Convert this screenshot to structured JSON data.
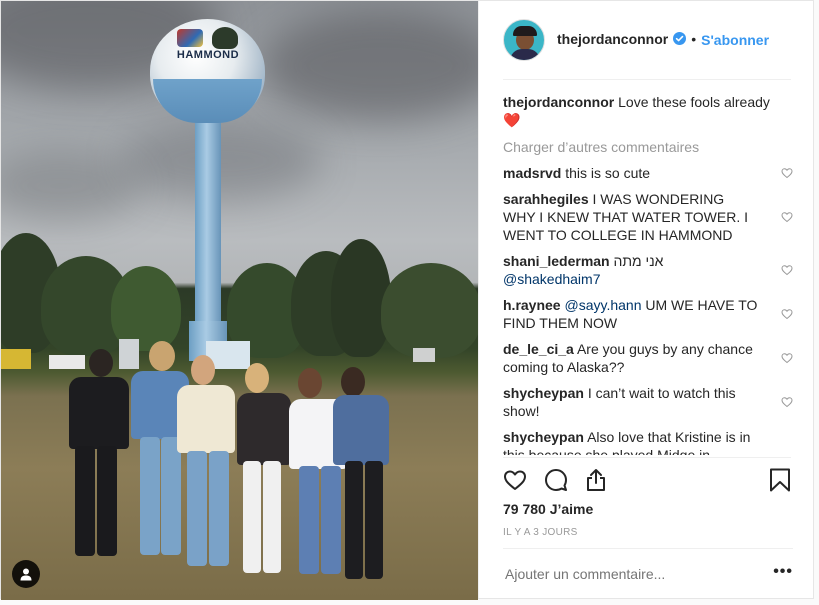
{
  "header": {
    "username": "thejordanconnor",
    "separator": "•",
    "follow_label": "S'abonner"
  },
  "caption": {
    "username": "thejordanconnor",
    "text": "Love these fools already",
    "emoji": "❤️"
  },
  "load_more_label": "Charger d’autres commentaires",
  "comments": [
    {
      "user": "madsrvd",
      "text": "this is so cute"
    },
    {
      "user": "sarahhegiles",
      "text": "I WAS WONDERING WHY I KNEW THAT WATER TOWER. I WENT TO COLLEGE IN HAMMOND"
    },
    {
      "user": "shani_lederman",
      "text": "אני מתה",
      "mention": "@shakedhaim7"
    },
    {
      "user": "h.raynee",
      "mention": "@sayy.hann",
      "text": "UM WE HAVE TO FIND THEM NOW"
    },
    {
      "user": "de_le_ci_a",
      "text": "Are you guys by any chance coming to Alaska??"
    },
    {
      "user": "shycheypan",
      "text": "I can’t wait to watch this show!"
    },
    {
      "user": "shycheypan",
      "text": "Also love that Kristine is in this because she played Midge in Riverdale and its very cool that now they’re in this series together"
    }
  ],
  "photo": {
    "tower_text": "HAMMOND"
  },
  "likes_label": "79 780 J’aime",
  "timestamp": "IL Y A 3 JOURS",
  "add_comment_placeholder": "Ajouter un commentaire...",
  "more_label": "•••",
  "icons": {
    "like": "heart-outline-icon",
    "comment": "speech-bubble-icon",
    "share": "share-icon",
    "save": "bookmark-icon",
    "verified": "verified-badge-icon",
    "user_tag": "user-tag-icon"
  },
  "colors": {
    "link": "#3897f0",
    "verified": "#3897f0",
    "text": "#262626",
    "muted": "#999999",
    "heart": "#ed4956"
  }
}
